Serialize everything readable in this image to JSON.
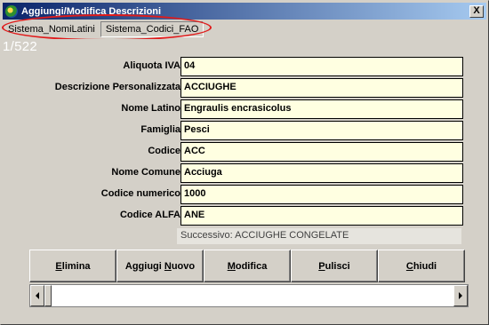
{
  "window": {
    "title": "Aggiungi/Modifica Descrizioni",
    "close_glyph": "X"
  },
  "menu": [
    {
      "label": "Sistema_NomiLatini"
    },
    {
      "label": "Sistema_Codici_FAO"
    }
  ],
  "record_counter": "1/522",
  "fields": [
    {
      "label": "Aliquota IVA",
      "value": "04"
    },
    {
      "label": "Descrizione Personalizzata",
      "value": "ACCIUGHE"
    },
    {
      "label": "Nome Latino",
      "value": "Engraulis encrasicolus"
    },
    {
      "label": "Famiglia",
      "value": "Pesci"
    },
    {
      "label": "Codice",
      "value": "ACC"
    },
    {
      "label": "Nome Comune",
      "value": "Acciuga"
    },
    {
      "label": "Codice numerico",
      "value": "1000"
    },
    {
      "label": "Codice ALFA",
      "value": "ANE"
    }
  ],
  "next_record": "Successivo:  ACCIUGHE CONGELATE",
  "buttons": [
    {
      "hot": "E",
      "rest": "limina"
    },
    {
      "pre": "Aggiugi ",
      "hot": "N",
      "rest": "uovo"
    },
    {
      "hot": "M",
      "rest": "odifica"
    },
    {
      "hot": "P",
      "rest": "ulisci"
    },
    {
      "hot": "C",
      "rest": "hiudi"
    }
  ],
  "colors": {
    "field_background": "#ffffe1",
    "titlebar_start": "#0a246a",
    "annotation": "#e01b1b"
  },
  "icons": {
    "app": "app-icon",
    "scroll_left": "arrow-left-icon",
    "scroll_right": "arrow-right-icon"
  }
}
